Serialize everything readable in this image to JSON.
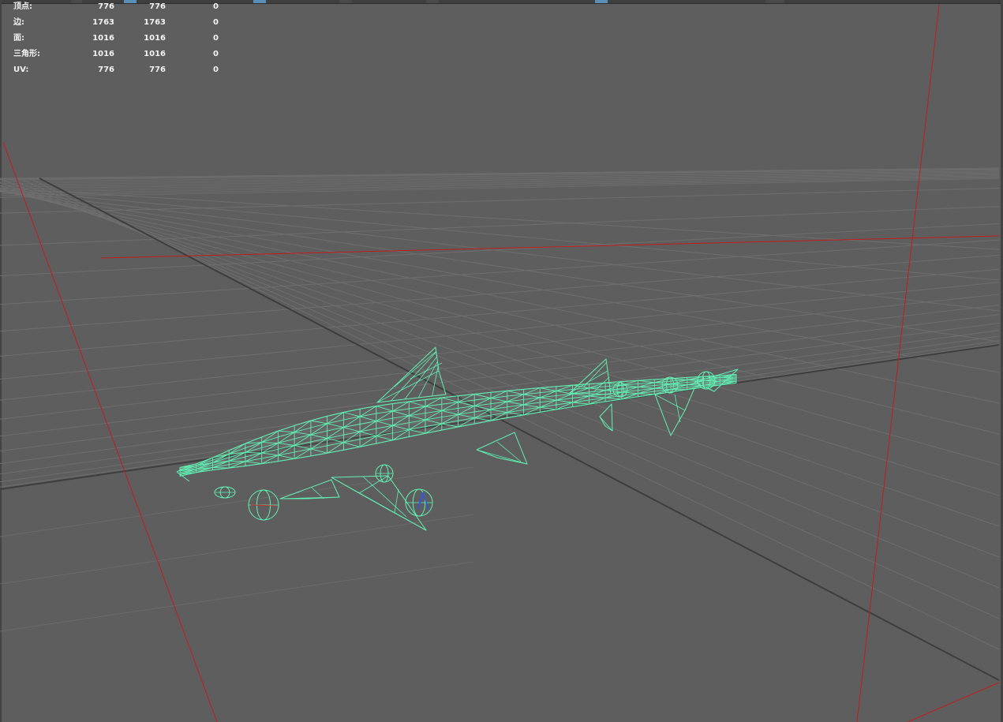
{
  "app": {
    "view": "perspective viewport",
    "display_mode": "wireframe"
  },
  "hud": {
    "rows": [
      {
        "label": "顶点:",
        "c1": "776",
        "c2": "776",
        "c3": "0"
      },
      {
        "label": "边:",
        "c1": "1763",
        "c2": "1763",
        "c3": "0"
      },
      {
        "label": "面:",
        "c1": "1016",
        "c2": "1016",
        "c3": "0"
      },
      {
        "label": "三角形:",
        "c1": "1016",
        "c2": "1016",
        "c3": "0"
      },
      {
        "label": "UV:",
        "c1": "776",
        "c2": "776",
        "c3": "0"
      }
    ]
  },
  "colors": {
    "background": "#5e5e5e",
    "grid": "#6e6e6e",
    "grid_axis": "#3e3e3e",
    "red_frame": "#c21d1d",
    "wireframe": "#61f0b4",
    "hud_text": "#f2f2f2"
  },
  "model": {
    "name": "shark"
  }
}
